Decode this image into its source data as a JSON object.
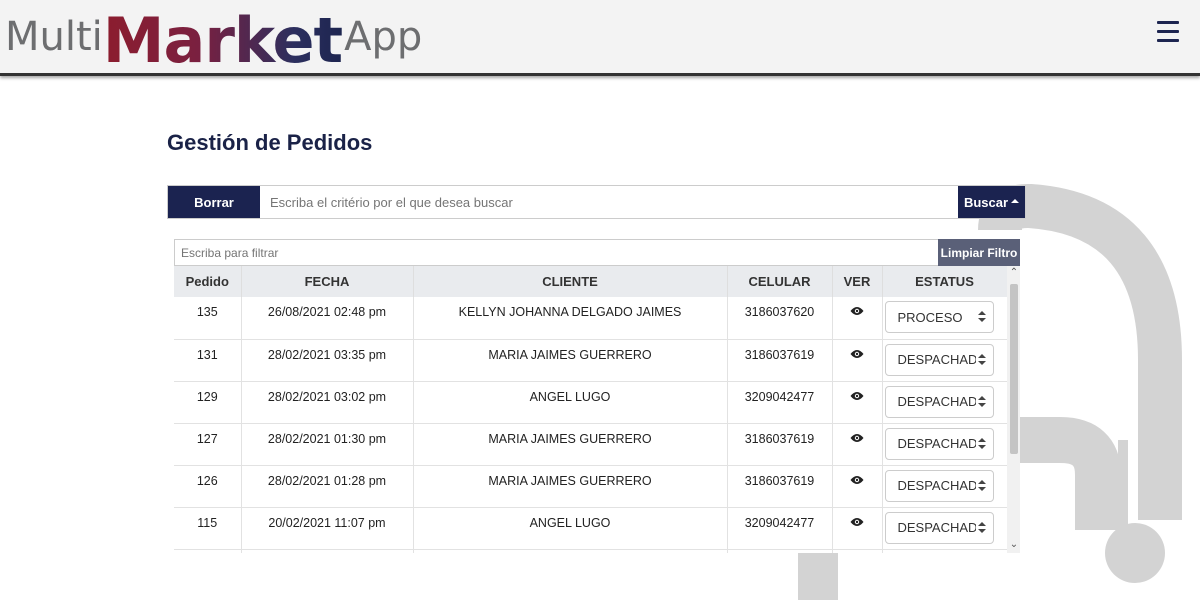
{
  "header": {
    "logo_multi": "Multi",
    "logo_market": "Market",
    "logo_app": "App",
    "menu_icon": "hamburger-icon"
  },
  "page": {
    "title": "Gestión de Pedidos"
  },
  "search": {
    "clear_label": "Borrar",
    "placeholder": "Escriba el critério por el que desea buscar",
    "search_label": "Buscar"
  },
  "filter": {
    "placeholder": "Escriba para filtrar",
    "clear_label": "Limpiar Filtro"
  },
  "table": {
    "columns": [
      "Pedido",
      "FECHA",
      "CLIENTE",
      "CELULAR",
      "VER",
      "ESTATUS"
    ],
    "rows": [
      {
        "pedido": "135",
        "fecha": "26/08/2021 02:48 pm",
        "cliente": "KELLYN JOHANNA DELGADO JAIMES",
        "celular": "3186037620",
        "estatus": "PROCESO",
        "flag_color": "#b41f2b"
      },
      {
        "pedido": "131",
        "fecha": "28/02/2021 03:35 pm",
        "cliente": "MARIA JAIMES GUERRERO",
        "celular": "3186037619",
        "estatus": "DESPACHADO",
        "flag_color": "#1b2350"
      },
      {
        "pedido": "129",
        "fecha": "28/02/2021 03:02 pm",
        "cliente": "ANGEL LUGO",
        "celular": "3209042477",
        "estatus": "DESPACHADO",
        "flag_color": "#1b2350"
      },
      {
        "pedido": "127",
        "fecha": "28/02/2021 01:30 pm",
        "cliente": "MARIA JAIMES GUERRERO",
        "celular": "3186037619",
        "estatus": "DESPACHADO",
        "flag_color": "#1b2350"
      },
      {
        "pedido": "126",
        "fecha": "28/02/2021 01:28 pm",
        "cliente": "MARIA JAIMES GUERRERO",
        "celular": "3186037619",
        "estatus": "DESPACHADO",
        "flag_color": "#1b2350"
      },
      {
        "pedido": "115",
        "fecha": "20/02/2021 11:07 pm",
        "cliente": "ANGEL LUGO",
        "celular": "3209042477",
        "estatus": "DESPACHADO",
        "flag_color": "#1b2350"
      }
    ]
  },
  "colors": {
    "brand_dark": "#1b2350",
    "brand_red": "#8c1d2e",
    "filter_button": "#5a6078"
  }
}
